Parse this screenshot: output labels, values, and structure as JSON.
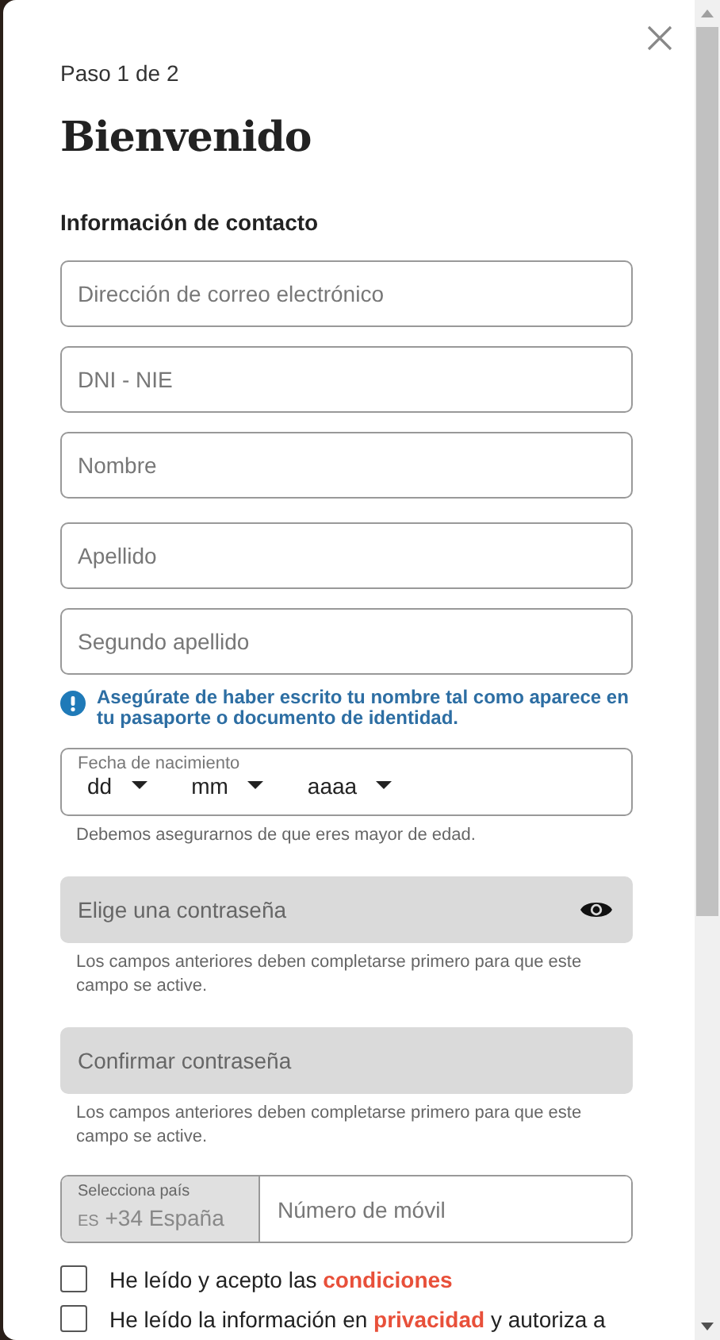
{
  "step": "Paso 1 de 2",
  "title": "Bienvenido",
  "section": "Información de contacto",
  "contact_fields": [
    {
      "placeholder": "Dirección de correo electrónico"
    },
    {
      "placeholder": "DNI - NIE"
    },
    {
      "placeholder": "Nombre"
    },
    {
      "placeholder": "Apellido"
    },
    {
      "placeholder": "Segundo apellido"
    }
  ],
  "notice": "Asegúrate de haber escrito tu nombre tal como aparece en tu pasaporte o documento de identidad.",
  "birth_date": {
    "label": "Fecha de nacimiento",
    "parts": [
      "dd",
      "mm",
      "aaaa"
    ],
    "hint": "Debemos asegurarnos de que eres mayor de edad."
  },
  "password_fields": [
    {
      "placeholder": "Elige una contraseña",
      "disabled": true,
      "reveal": true,
      "hint": "Los campos anteriores deben completarse primero para que este campo se active."
    },
    {
      "placeholder": "Confirmar contraseña",
      "disabled": true,
      "reveal": false,
      "hint": "Los campos anteriores deben completarse primero para que este campo se active."
    }
  ],
  "phone": {
    "country_label": "Selecciona país",
    "country_code": "ES",
    "country_value": "+34 España",
    "placeholder": "Número de móvil"
  },
  "agreements": [
    {
      "checked": false,
      "before": "He leído y acepto las ",
      "link": "condiciones"
    },
    {
      "checked": false,
      "before": "He leído la información en ",
      "link": "privacidad",
      "after": " y autoriza a"
    }
  ]
}
